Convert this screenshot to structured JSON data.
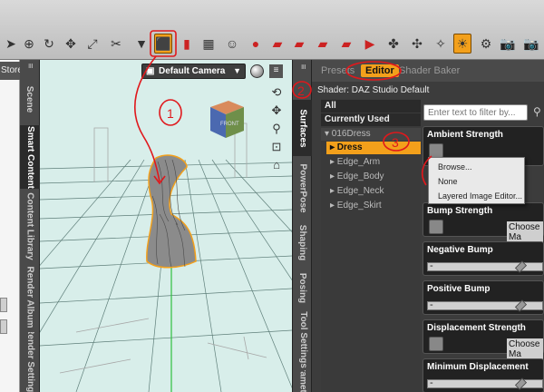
{
  "left_panel": {
    "store_tab": "Store"
  },
  "left_tabs": [
    "Scene",
    "Smart Content",
    "Content Library",
    "Render Album",
    "Render Settings"
  ],
  "viewport": {
    "camera": "Default Camera",
    "cube_label": "FRONT"
  },
  "mid_tabs": [
    "Surfaces",
    "PowerPose",
    "Shaping",
    "Posing",
    "Tool Settings",
    "Parameters"
  ],
  "pane": {
    "tabs": [
      "Presets",
      "Editor",
      "Shader Baker"
    ],
    "shader": "Shader: DAZ Studio Default",
    "filter_placeholder": "Enter text to filter by...",
    "tree": {
      "all": "All",
      "current": "Currently Used",
      "group": "▾ 016Dress",
      "selected": "▸ Dress",
      "items": [
        "▸ Edge_Arm",
        "▸ Edge_Body",
        "▸ Edge_Neck",
        "▸ Edge_Skirt"
      ]
    },
    "properties": [
      {
        "label": "Ambient Strength"
      },
      {
        "label": "Bump Strength",
        "choose": "Choose Ma"
      },
      {
        "label": "Negative Bump"
      },
      {
        "label": "Positive Bump"
      },
      {
        "label": "Displacement Strength",
        "choose": "Choose Ma"
      },
      {
        "label": "Minimum Displacement"
      }
    ],
    "context_menu": [
      "Browse...",
      "None",
      "Layered Image Editor..."
    ]
  },
  "annotations": {
    "n1": "1",
    "n2": "2",
    "n3": "3"
  },
  "colors": {
    "accent": "#f3a01b",
    "viewport": "#d8eeea",
    "annotation": "#e0181c"
  }
}
